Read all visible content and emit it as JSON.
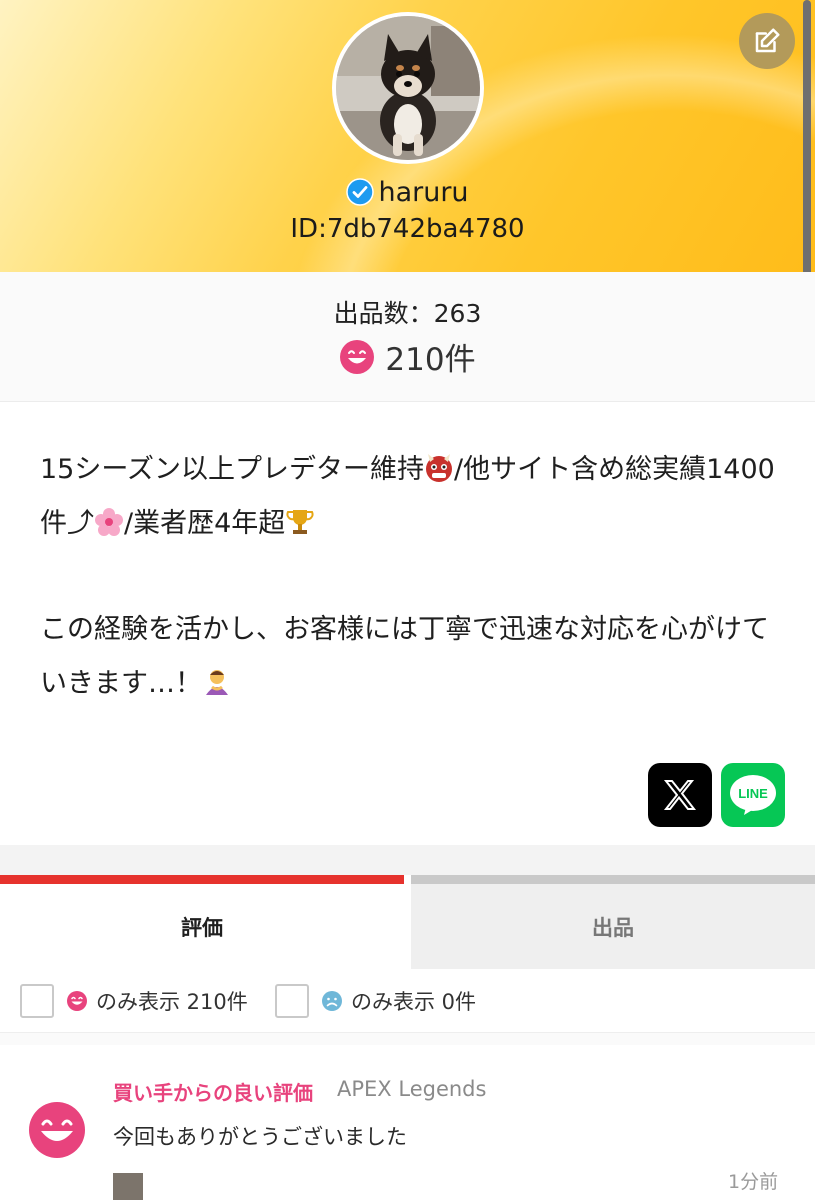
{
  "profile": {
    "username": "haruru",
    "user_id": "ID:7db742ba4780",
    "verified": true
  },
  "stats": {
    "listings": "出品数：263",
    "rating_total": "210件"
  },
  "bio": {
    "line1_a": "15シーズン以上プレデター維持",
    "line1_b": "/他サイト含め総実績1400件⤴",
    "line1_c": "/業者歴4年超",
    "line2": "この経験を活かし、お客様には丁寧で迅速な対応を心がけていきます…！"
  },
  "social": {
    "x_label": "X",
    "line_label": "LINE"
  },
  "tabs": {
    "reviews": "評価",
    "items": "出品"
  },
  "filters": {
    "good": "のみ表示 210件",
    "bad": "のみ表示 0件"
  },
  "review": {
    "type": "買い手からの良い評価",
    "game": "APEX Legends",
    "comment": "今回もありがとうございました",
    "time": "1分前"
  },
  "colors": {
    "accent_red": "#e6322d",
    "good_pink": "#e8437d",
    "bad_blue": "#6fb7d8",
    "line_green": "#06c755",
    "header_yellow": "#ffc62a"
  },
  "icons": [
    "edit-icon",
    "verified-icon",
    "smile-face-icon",
    "sad-face-icon",
    "oni-mask-icon",
    "cherry-blossom-icon",
    "trophy-icon",
    "bowing-person-icon",
    "x-logo-icon",
    "line-logo-icon"
  ]
}
